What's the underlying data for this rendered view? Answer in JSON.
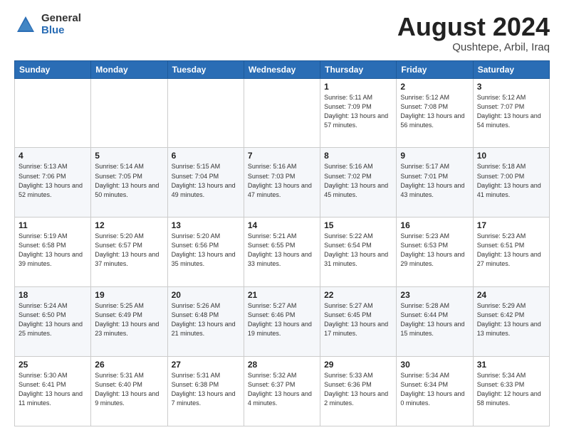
{
  "logo": {
    "general": "General",
    "blue": "Blue"
  },
  "title": {
    "month_year": "August 2024",
    "location": "Qushtepe, Arbil, Iraq"
  },
  "days_of_week": [
    "Sunday",
    "Monday",
    "Tuesday",
    "Wednesday",
    "Thursday",
    "Friday",
    "Saturday"
  ],
  "weeks": [
    [
      {
        "day": "",
        "content": ""
      },
      {
        "day": "",
        "content": ""
      },
      {
        "day": "",
        "content": ""
      },
      {
        "day": "",
        "content": ""
      },
      {
        "day": "1",
        "content": "Sunrise: 5:11 AM\nSunset: 7:09 PM\nDaylight: 13 hours\nand 57 minutes."
      },
      {
        "day": "2",
        "content": "Sunrise: 5:12 AM\nSunset: 7:08 PM\nDaylight: 13 hours\nand 56 minutes."
      },
      {
        "day": "3",
        "content": "Sunrise: 5:12 AM\nSunset: 7:07 PM\nDaylight: 13 hours\nand 54 minutes."
      }
    ],
    [
      {
        "day": "4",
        "content": "Sunrise: 5:13 AM\nSunset: 7:06 PM\nDaylight: 13 hours\nand 52 minutes."
      },
      {
        "day": "5",
        "content": "Sunrise: 5:14 AM\nSunset: 7:05 PM\nDaylight: 13 hours\nand 50 minutes."
      },
      {
        "day": "6",
        "content": "Sunrise: 5:15 AM\nSunset: 7:04 PM\nDaylight: 13 hours\nand 49 minutes."
      },
      {
        "day": "7",
        "content": "Sunrise: 5:16 AM\nSunset: 7:03 PM\nDaylight: 13 hours\nand 47 minutes."
      },
      {
        "day": "8",
        "content": "Sunrise: 5:16 AM\nSunset: 7:02 PM\nDaylight: 13 hours\nand 45 minutes."
      },
      {
        "day": "9",
        "content": "Sunrise: 5:17 AM\nSunset: 7:01 PM\nDaylight: 13 hours\nand 43 minutes."
      },
      {
        "day": "10",
        "content": "Sunrise: 5:18 AM\nSunset: 7:00 PM\nDaylight: 13 hours\nand 41 minutes."
      }
    ],
    [
      {
        "day": "11",
        "content": "Sunrise: 5:19 AM\nSunset: 6:58 PM\nDaylight: 13 hours\nand 39 minutes."
      },
      {
        "day": "12",
        "content": "Sunrise: 5:20 AM\nSunset: 6:57 PM\nDaylight: 13 hours\nand 37 minutes."
      },
      {
        "day": "13",
        "content": "Sunrise: 5:20 AM\nSunset: 6:56 PM\nDaylight: 13 hours\nand 35 minutes."
      },
      {
        "day": "14",
        "content": "Sunrise: 5:21 AM\nSunset: 6:55 PM\nDaylight: 13 hours\nand 33 minutes."
      },
      {
        "day": "15",
        "content": "Sunrise: 5:22 AM\nSunset: 6:54 PM\nDaylight: 13 hours\nand 31 minutes."
      },
      {
        "day": "16",
        "content": "Sunrise: 5:23 AM\nSunset: 6:53 PM\nDaylight: 13 hours\nand 29 minutes."
      },
      {
        "day": "17",
        "content": "Sunrise: 5:23 AM\nSunset: 6:51 PM\nDaylight: 13 hours\nand 27 minutes."
      }
    ],
    [
      {
        "day": "18",
        "content": "Sunrise: 5:24 AM\nSunset: 6:50 PM\nDaylight: 13 hours\nand 25 minutes."
      },
      {
        "day": "19",
        "content": "Sunrise: 5:25 AM\nSunset: 6:49 PM\nDaylight: 13 hours\nand 23 minutes."
      },
      {
        "day": "20",
        "content": "Sunrise: 5:26 AM\nSunset: 6:48 PM\nDaylight: 13 hours\nand 21 minutes."
      },
      {
        "day": "21",
        "content": "Sunrise: 5:27 AM\nSunset: 6:46 PM\nDaylight: 13 hours\nand 19 minutes."
      },
      {
        "day": "22",
        "content": "Sunrise: 5:27 AM\nSunset: 6:45 PM\nDaylight: 13 hours\nand 17 minutes."
      },
      {
        "day": "23",
        "content": "Sunrise: 5:28 AM\nSunset: 6:44 PM\nDaylight: 13 hours\nand 15 minutes."
      },
      {
        "day": "24",
        "content": "Sunrise: 5:29 AM\nSunset: 6:42 PM\nDaylight: 13 hours\nand 13 minutes."
      }
    ],
    [
      {
        "day": "25",
        "content": "Sunrise: 5:30 AM\nSunset: 6:41 PM\nDaylight: 13 hours\nand 11 minutes."
      },
      {
        "day": "26",
        "content": "Sunrise: 5:31 AM\nSunset: 6:40 PM\nDaylight: 13 hours\nand 9 minutes."
      },
      {
        "day": "27",
        "content": "Sunrise: 5:31 AM\nSunset: 6:38 PM\nDaylight: 13 hours\nand 7 minutes."
      },
      {
        "day": "28",
        "content": "Sunrise: 5:32 AM\nSunset: 6:37 PM\nDaylight: 13 hours\nand 4 minutes."
      },
      {
        "day": "29",
        "content": "Sunrise: 5:33 AM\nSunset: 6:36 PM\nDaylight: 13 hours\nand 2 minutes."
      },
      {
        "day": "30",
        "content": "Sunrise: 5:34 AM\nSunset: 6:34 PM\nDaylight: 13 hours\nand 0 minutes."
      },
      {
        "day": "31",
        "content": "Sunrise: 5:34 AM\nSunset: 6:33 PM\nDaylight: 12 hours\nand 58 minutes."
      }
    ]
  ]
}
